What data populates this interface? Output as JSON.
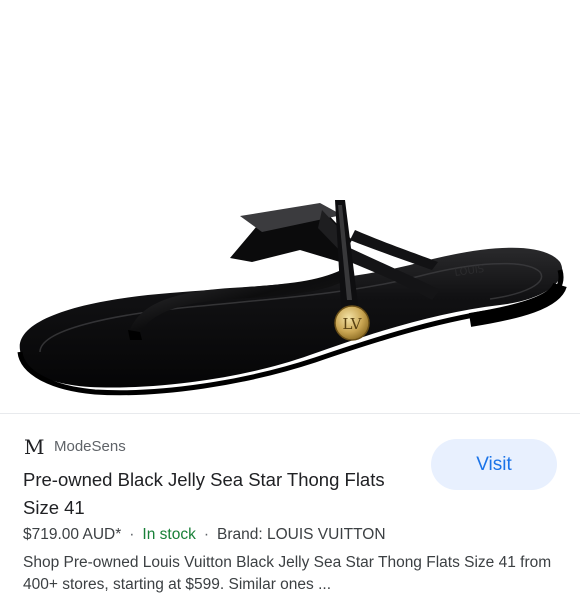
{
  "product_image": {
    "icon": "black-jelly-thong-sandal-image",
    "emblem_text": "LV"
  },
  "result": {
    "source_logo": "M",
    "source_name": "ModeSens",
    "visit_label": "Visit",
    "title": "Pre-owned Black Jelly Sea Star Thong Flats Size 41",
    "price": "$719.00 AUD*",
    "availability": "In stock",
    "brand": "Brand: LOUIS VUITTON",
    "separator": "·",
    "description": "Shop Pre-owned Louis Vuitton Black Jelly Sea Star Thong Flats Size 41 from 400+ stores, starting at $599. Similar ones ..."
  },
  "colors": {
    "accent": "#1a73e8",
    "visit_background": "#e8f0fe",
    "in_stock": "#188038",
    "sandal": "#0b0b0c"
  }
}
